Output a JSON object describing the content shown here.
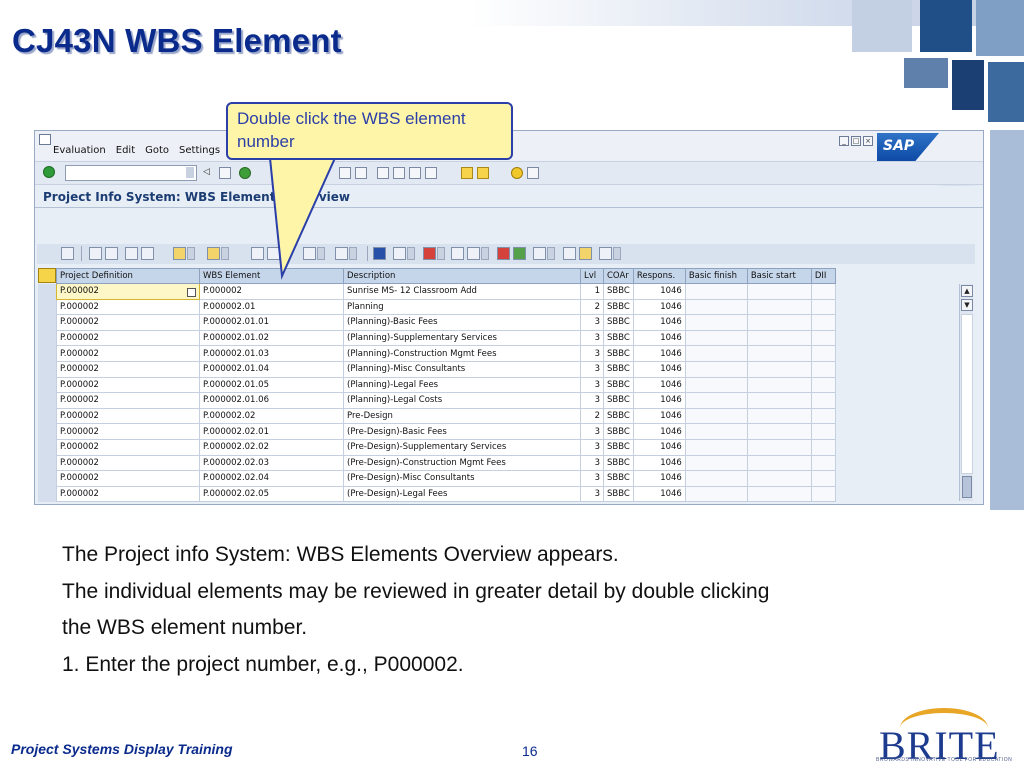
{
  "slide": {
    "title": "CJ43N WBS Element",
    "footer_left": "Project Systems Display Training",
    "page_number": "16",
    "logo_text": "BRITE",
    "logo_tagline": "BROWARDS INNOVATIVE TOOL FOR EDUCATION"
  },
  "callout": {
    "text": "Double click the WBS element number"
  },
  "sap": {
    "menu": [
      "Evaluation",
      "Edit",
      "Goto",
      "Settings"
    ],
    "logo": "SAP",
    "screen_title": "Project Info System: WBS Elements Overview",
    "grid": {
      "columns": [
        "Project Definition",
        "WBS Element",
        "Description",
        "Lvl",
        "COAr",
        "Respons.",
        "Basic finish",
        "Basic start",
        "DII"
      ],
      "rows": [
        [
          "P.000002",
          "P.000002",
          "Sunrise MS- 12 Classroom Add",
          "1",
          "SBBC",
          "1046",
          "",
          "",
          ""
        ],
        [
          "P.000002",
          "P.000002.01",
          "Planning",
          "2",
          "SBBC",
          "1046",
          "",
          "",
          ""
        ],
        [
          "P.000002",
          "P.000002.01.01",
          "(Planning)-Basic Fees",
          "3",
          "SBBC",
          "1046",
          "",
          "",
          ""
        ],
        [
          "P.000002",
          "P.000002.01.02",
          "(Planning)-Supplementary Services",
          "3",
          "SBBC",
          "1046",
          "",
          "",
          ""
        ],
        [
          "P.000002",
          "P.000002.01.03",
          "(Planning)-Construction Mgmt Fees",
          "3",
          "SBBC",
          "1046",
          "",
          "",
          ""
        ],
        [
          "P.000002",
          "P.000002.01.04",
          "(Planning)-Misc Consultants",
          "3",
          "SBBC",
          "1046",
          "",
          "",
          ""
        ],
        [
          "P.000002",
          "P.000002.01.05",
          "(Planning)-Legal Fees",
          "3",
          "SBBC",
          "1046",
          "",
          "",
          ""
        ],
        [
          "P.000002",
          "P.000002.01.06",
          "(Planning)-Legal Costs",
          "3",
          "SBBC",
          "1046",
          "",
          "",
          ""
        ],
        [
          "P.000002",
          "P.000002.02",
          "Pre-Design",
          "2",
          "SBBC",
          "1046",
          "",
          "",
          ""
        ],
        [
          "P.000002",
          "P.000002.02.01",
          "(Pre-Design)-Basic Fees",
          "3",
          "SBBC",
          "1046",
          "",
          "",
          ""
        ],
        [
          "P.000002",
          "P.000002.02.02",
          "(Pre-Design)-Supplementary Services",
          "3",
          "SBBC",
          "1046",
          "",
          "",
          ""
        ],
        [
          "P.000002",
          "P.000002.02.03",
          "(Pre-Design)-Construction Mgmt Fees",
          "3",
          "SBBC",
          "1046",
          "",
          "",
          ""
        ],
        [
          "P.000002",
          "P.000002.02.04",
          "(Pre-Design)-Misc Consultants",
          "3",
          "SBBC",
          "1046",
          "",
          "",
          ""
        ],
        [
          "P.000002",
          "P.000002.02.05",
          "(Pre-Design)-Legal Fees",
          "3",
          "SBBC",
          "1046",
          "",
          "",
          ""
        ]
      ]
    }
  },
  "body": {
    "lines": [
      "The Project info System: WBS Elements Overview appears.",
      "The individual elements may be reviewed in greater detail by double clicking",
      "the WBS element number.",
      "1.  Enter the project number, e.g., P000002."
    ]
  },
  "colors": {
    "title_blue": "#0a2a8c",
    "callout_fill": "#fff5a8",
    "callout_border": "#2a3fa8",
    "grid_header": "#c6d6ea",
    "logo_orange": "#e8a526"
  },
  "icons": [
    "enter-icon",
    "back-icon",
    "save-icon",
    "print-icon",
    "find-icon",
    "help-icon",
    "details-icon",
    "sort-ascending-icon",
    "sort-descending-icon",
    "filter-icon",
    "total-icon",
    "export-icon",
    "layout-icon",
    "info-icon"
  ]
}
